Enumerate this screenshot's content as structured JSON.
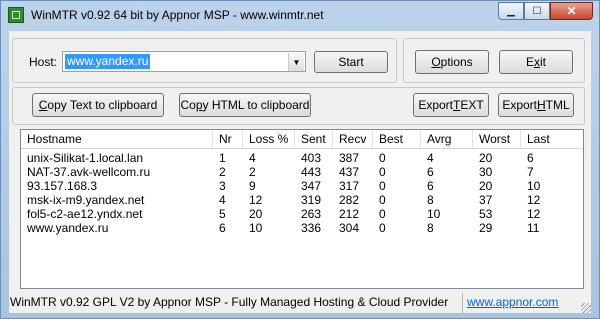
{
  "window": {
    "title": "WinMTR v0.92 64 bit by Appnor MSP - www.winmtr.net",
    "minimize_glyph": "▁",
    "maximize_glyph": "☐",
    "close_glyph": "✕"
  },
  "host_group": {
    "label": "Host:",
    "combo_value": "www.yandex.ru",
    "start_label": "Start"
  },
  "options_group": {
    "options_label": "Options",
    "exit_label": "Exit"
  },
  "export_group": {
    "copy_text_label": "Copy Text to clipboard",
    "copy_html_label": "Copy HTML to clipboard",
    "export_text_label": "Export TEXT",
    "export_html_label": "Export HTML"
  },
  "table": {
    "columns": [
      "Hostname",
      "Nr",
      "Loss %",
      "Sent",
      "Recv",
      "Best",
      "Avrg",
      "Worst",
      "Last"
    ],
    "rows": [
      [
        "unix-Silikat-1.local.lan",
        "1",
        "4",
        "403",
        "387",
        "0",
        "4",
        "20",
        "6"
      ],
      [
        "NAT-37.avk-wellcom.ru",
        "2",
        "2",
        "443",
        "437",
        "0",
        "6",
        "30",
        "7"
      ],
      [
        "93.157.168.3",
        "3",
        "9",
        "347",
        "317",
        "0",
        "6",
        "20",
        "10"
      ],
      [
        "msk-ix-m9.yandex.net",
        "4",
        "12",
        "319",
        "282",
        "0",
        "8",
        "37",
        "12"
      ],
      [
        "fol5-c2-ae12.yndx.net",
        "5",
        "20",
        "263",
        "212",
        "0",
        "10",
        "53",
        "12"
      ],
      [
        "www.yandex.ru",
        "6",
        "10",
        "336",
        "304",
        "0",
        "8",
        "29",
        "11"
      ]
    ]
  },
  "statusbar": {
    "text": "WinMTR v0.92 GPL V2 by Appnor MSP - Fully Managed Hosting & Cloud Provider",
    "link": "www.appnor.com"
  },
  "colors": {
    "title_bar": "#bcd3ea",
    "selection": "#3399ff",
    "link": "#0066cc",
    "close_button": "#c7452f"
  }
}
